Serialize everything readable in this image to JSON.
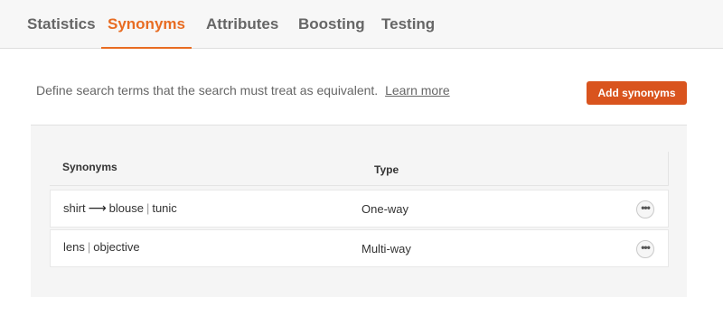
{
  "tabs": [
    {
      "label": "Statistics",
      "active": false
    },
    {
      "label": "Synonyms",
      "active": true
    },
    {
      "label": "Attributes",
      "active": false
    },
    {
      "label": "Boosting",
      "active": false
    },
    {
      "label": "Testing",
      "active": false
    }
  ],
  "intro": {
    "text": "Define search terms that the search must treat as equivalent.",
    "link": "Learn more"
  },
  "add_button_label": "Add synonyms",
  "table": {
    "headers": {
      "synonyms": "Synonyms",
      "type": "Type"
    },
    "rows": [
      {
        "term": "shirt",
        "arrow": "⟶",
        "synonyms": [
          "blouse",
          "tunic"
        ],
        "type": "One-way"
      },
      {
        "term": "lens",
        "arrow": "",
        "synonyms": [
          "objective"
        ],
        "type": "Multi-way"
      }
    ],
    "separator": "|",
    "more_icon": "•••"
  },
  "colors": {
    "accent": "#e86c22",
    "button": "#d9541e"
  }
}
